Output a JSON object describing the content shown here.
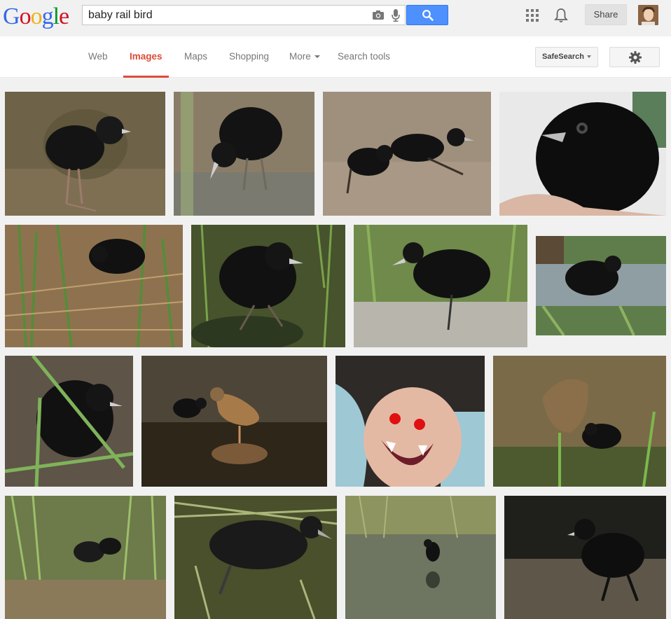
{
  "header": {
    "logo_text": "Google",
    "search_value": "baby rail bird",
    "search_placeholder": "",
    "share_label": "Share",
    "icons": [
      "camera-icon",
      "microphone-icon",
      "search-icon",
      "apps-grid-icon",
      "notification-bell-icon",
      "gear-icon",
      "profile-avatar"
    ]
  },
  "nav": {
    "tabs": [
      {
        "label": "Web",
        "active": false
      },
      {
        "label": "Images",
        "active": true
      },
      {
        "label": "Maps",
        "active": false
      },
      {
        "label": "Shopping",
        "active": false
      },
      {
        "label": "More",
        "active": false
      },
      {
        "label": "Search tools",
        "active": false
      }
    ],
    "safesearch_label": "SafeSearch"
  },
  "colors": {
    "accent_red": "#dd4b39",
    "search_button_blue": "#4d90fe",
    "background": "#f1f1f1"
  },
  "results": {
    "count": 16,
    "description": "image thumbnails for baby rail bird"
  }
}
